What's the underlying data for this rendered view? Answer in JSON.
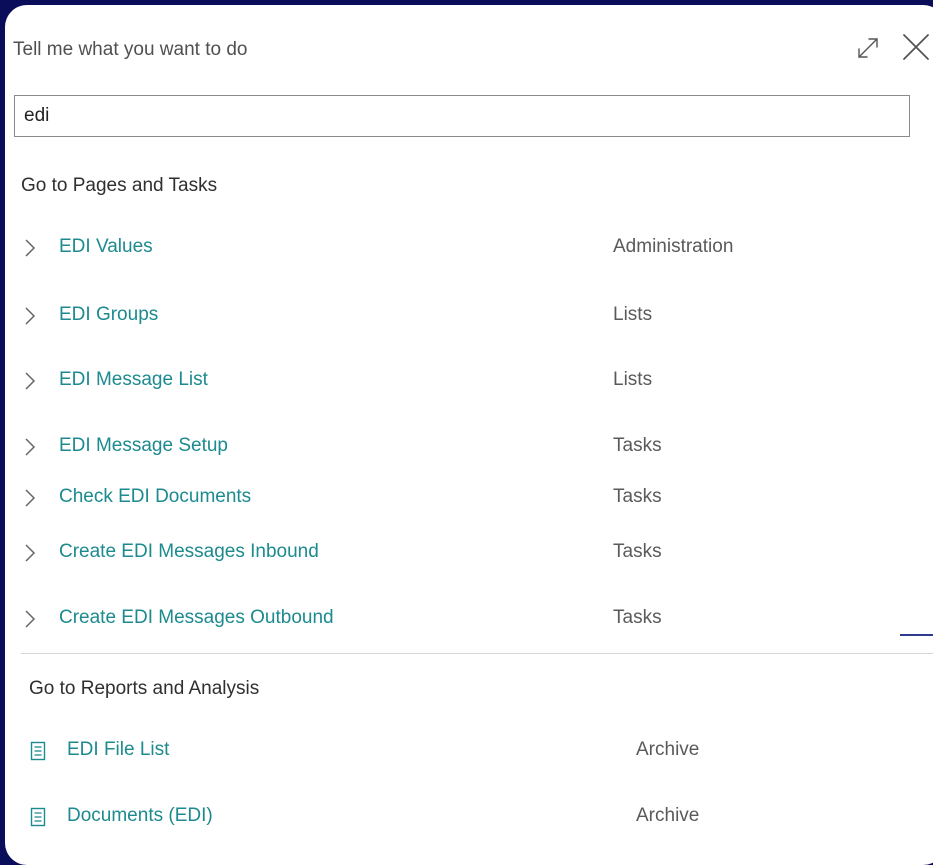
{
  "dialog": {
    "title": "Tell me what you want to do",
    "expand_icon": "expand-icon",
    "close_icon": "close-icon"
  },
  "search": {
    "value": "edi"
  },
  "pages_section": {
    "title": "Go to Pages and Tasks",
    "items": [
      {
        "label": "EDI Values",
        "category": "Administration"
      },
      {
        "label": "EDI Groups",
        "category": "Lists"
      },
      {
        "label": "EDI Message List",
        "category": "Lists"
      },
      {
        "label": "EDI Message Setup",
        "category": "Tasks"
      },
      {
        "label": "Check EDI Documents",
        "category": "Tasks"
      },
      {
        "label": "Create EDI Messages Inbound",
        "category": "Tasks"
      },
      {
        "label": "Create EDI Messages Outbound",
        "category": "Tasks"
      }
    ]
  },
  "reports_section": {
    "title": "Go to Reports and Analysis",
    "items": [
      {
        "label": "EDI File List",
        "category": "Archive"
      },
      {
        "label": "Documents (EDI)",
        "category": "Archive"
      }
    ]
  },
  "colors": {
    "link": "#1c8a8f",
    "background": "#0a0d5a"
  }
}
